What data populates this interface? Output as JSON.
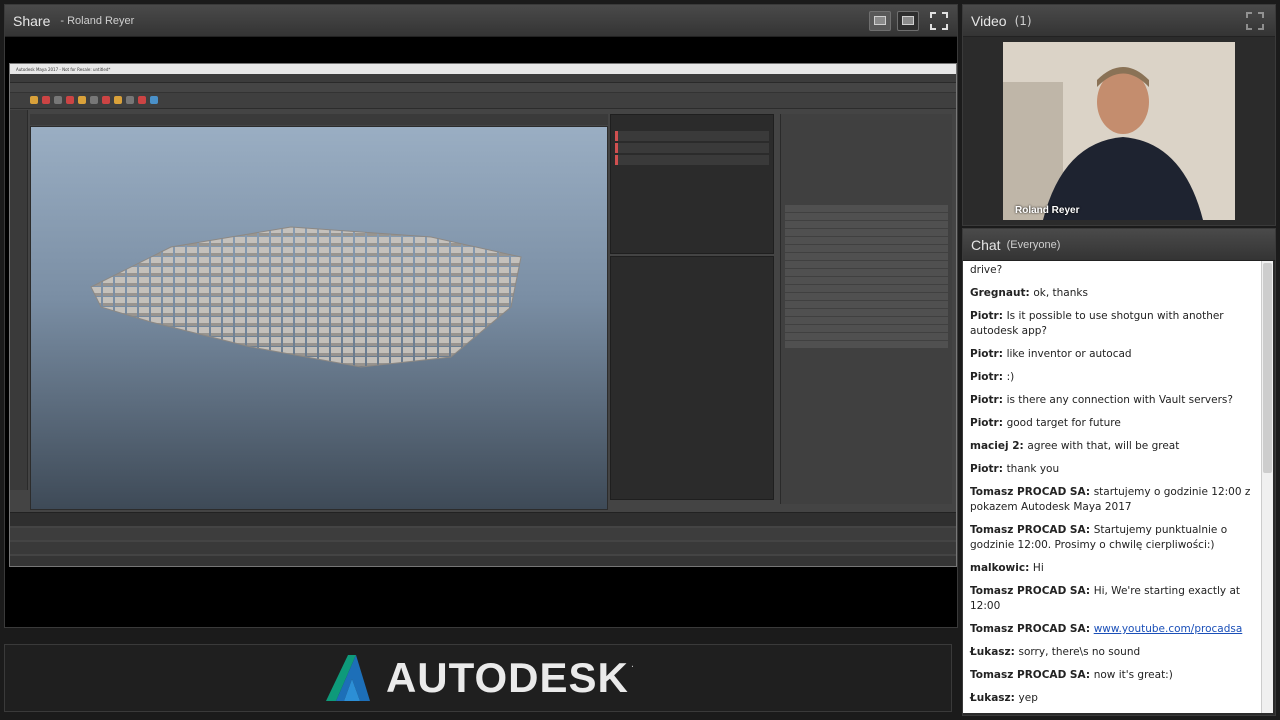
{
  "share": {
    "title": "Share",
    "presenter": "- Roland Reyer"
  },
  "maya": {
    "window_title": "Autodesk Maya 2017 - Not for Resale: untitled*"
  },
  "banner": {
    "brand": "AUTODESK",
    "tm": "."
  },
  "video": {
    "title": "Video",
    "count": "(1)",
    "name": "Roland Reyer"
  },
  "chat": {
    "title": "Chat",
    "scope": "(Everyone)",
    "messages": [
      {
        "who": "",
        "text": "drive?"
      },
      {
        "who": "Gregnaut:",
        "text": "ok, thanks"
      },
      {
        "who": "Piotr:",
        "text": "Is it possible to use shotgun with another autodesk app?"
      },
      {
        "who": "Piotr:",
        "text": "like inventor or autocad"
      },
      {
        "who": "Piotr:",
        "text": ":)"
      },
      {
        "who": "Piotr:",
        "text": "is there any connection with Vault servers?"
      },
      {
        "who": "Piotr:",
        "text": "good target for future"
      },
      {
        "who": "maciej 2:",
        "text": "agree with that, will be great"
      },
      {
        "who": "Piotr:",
        "text": "thank you"
      },
      {
        "who": "Tomasz PROCAD SA:",
        "text": "startujemy o godzinie 12:00 z pokazem Autodesk Maya 2017"
      },
      {
        "who": "Tomasz PROCAD SA:",
        "text": "Startujemy punktualnie o godzinie 12:00. Prosimy o chwilę cierpliwości:)"
      },
      {
        "who": "malkowic:",
        "text": "Hi"
      },
      {
        "who": "Tomasz PROCAD SA:",
        "text": "Hi, We're starting exactly at 12:00"
      },
      {
        "who": "Tomasz PROCAD SA:",
        "text": "www.youtube.com/procadsa",
        "link": true
      },
      {
        "who": "Łukasz:",
        "text": "sorry, there\\s no sound"
      },
      {
        "who": "Tomasz PROCAD SA:",
        "text": "now it's great:)"
      },
      {
        "who": "Łukasz:",
        "text": "yep"
      }
    ]
  }
}
